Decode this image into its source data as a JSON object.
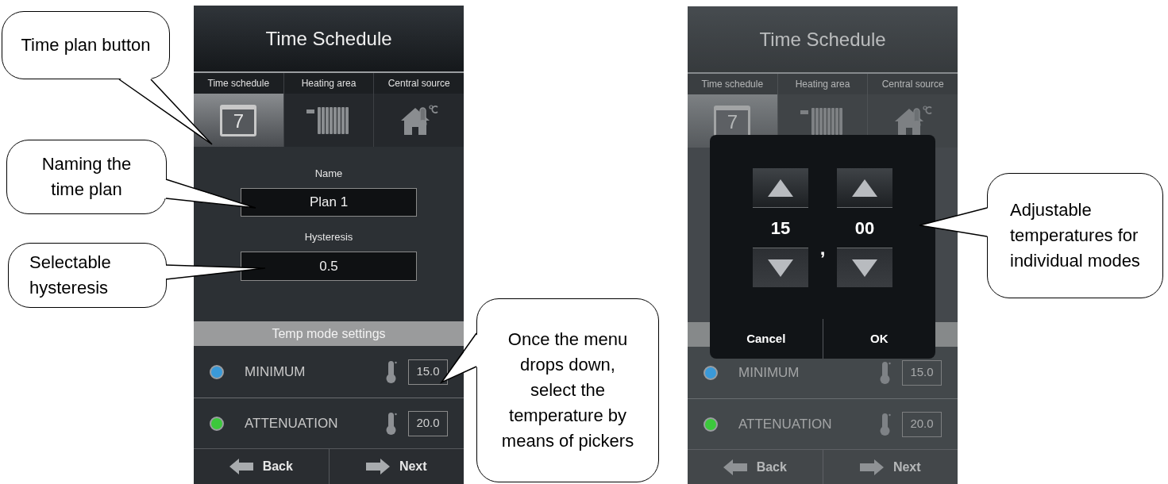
{
  "callouts": [
    {
      "text": "Time plan button"
    },
    {
      "text": "Naming the time plan"
    },
    {
      "text": "Selectable hysteresis"
    },
    {
      "text": "Once the menu drops down, select the temperature by means of pickers"
    },
    {
      "text": "Adjustable temperatures for individual modes"
    }
  ],
  "screens": [
    {
      "title": "Time Schedule",
      "tabs": [
        {
          "label": "Time schedule",
          "kind": "calendar",
          "icon_text": "7",
          "selected": true
        },
        {
          "label": "Heating area",
          "kind": "radiator",
          "selected": false
        },
        {
          "label": "Central source",
          "kind": "house",
          "selected": false
        }
      ],
      "form": {
        "name_label": "Name",
        "name_value": "Plan 1",
        "hysteresis_label": "Hysteresis",
        "hysteresis_value": "0.5",
        "section": "Temp mode settings"
      },
      "modes": [
        {
          "name": "MINIMUM",
          "value": "15.0",
          "color": "#3a9ad9"
        },
        {
          "name": "ATTENUATION",
          "value": "20.0",
          "color": "#3cc83c"
        }
      ],
      "footer": [
        {
          "label": "Back",
          "kind": "back"
        },
        {
          "label": "Next",
          "kind": "next"
        }
      ]
    },
    {
      "title": "Time Schedule",
      "tabs": [
        {
          "label": "Time schedule",
          "kind": "calendar",
          "icon_text": "7",
          "selected": true
        },
        {
          "label": "Heating area",
          "kind": "radiator",
          "selected": false
        },
        {
          "label": "Central source",
          "kind": "house",
          "selected": false
        }
      ],
      "picker": {
        "whole": "15",
        "separator": ",",
        "fraction": "00",
        "buttons": [
          "Cancel",
          "OK"
        ]
      },
      "modes": [
        {
          "name": "MINIMUM",
          "value": "15.0",
          "color": "#3a9ad9"
        },
        {
          "name": "ATTENUATION",
          "value": "20.0",
          "color": "#3cc83c"
        }
      ],
      "footer": [
        {
          "label": "Back",
          "kind": "back"
        },
        {
          "label": "Next",
          "kind": "next"
        }
      ]
    }
  ]
}
